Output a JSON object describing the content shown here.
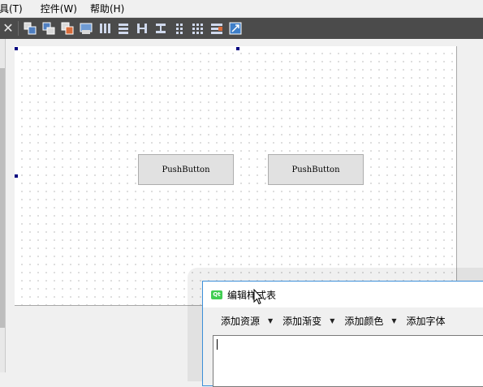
{
  "menubar": {
    "items": [
      "工具(T)",
      "控件(W)",
      "帮助(H)"
    ],
    "display": [
      "具(T)",
      "控件(W)",
      "帮助(H)"
    ]
  },
  "toolbar": {
    "icons": [
      "layout-horizontal-icon",
      "layout-vertical-icon",
      "layout-splitter-icon",
      "layout-grid-icon",
      "columns-icon",
      "rows-icon",
      "horizontal-spacer-icon",
      "vertical-spacer-icon",
      "grid-dots-icon",
      "form-layout-icon",
      "break-layout-icon",
      "adjust-size-icon"
    ]
  },
  "form": {
    "buttons": [
      "PushButton",
      "PushButton"
    ]
  },
  "dialog": {
    "title": "编辑样式表",
    "actions": [
      "添加资源",
      "添加渐变",
      "添加颜色",
      "添加字体"
    ],
    "dropdown_arrow": "▼"
  },
  "colors": {
    "toolbar_bg": "#4b4b4b",
    "handle": "#00007f",
    "dialog_border": "#3c8fd9",
    "qt_green": "#41cd52"
  }
}
